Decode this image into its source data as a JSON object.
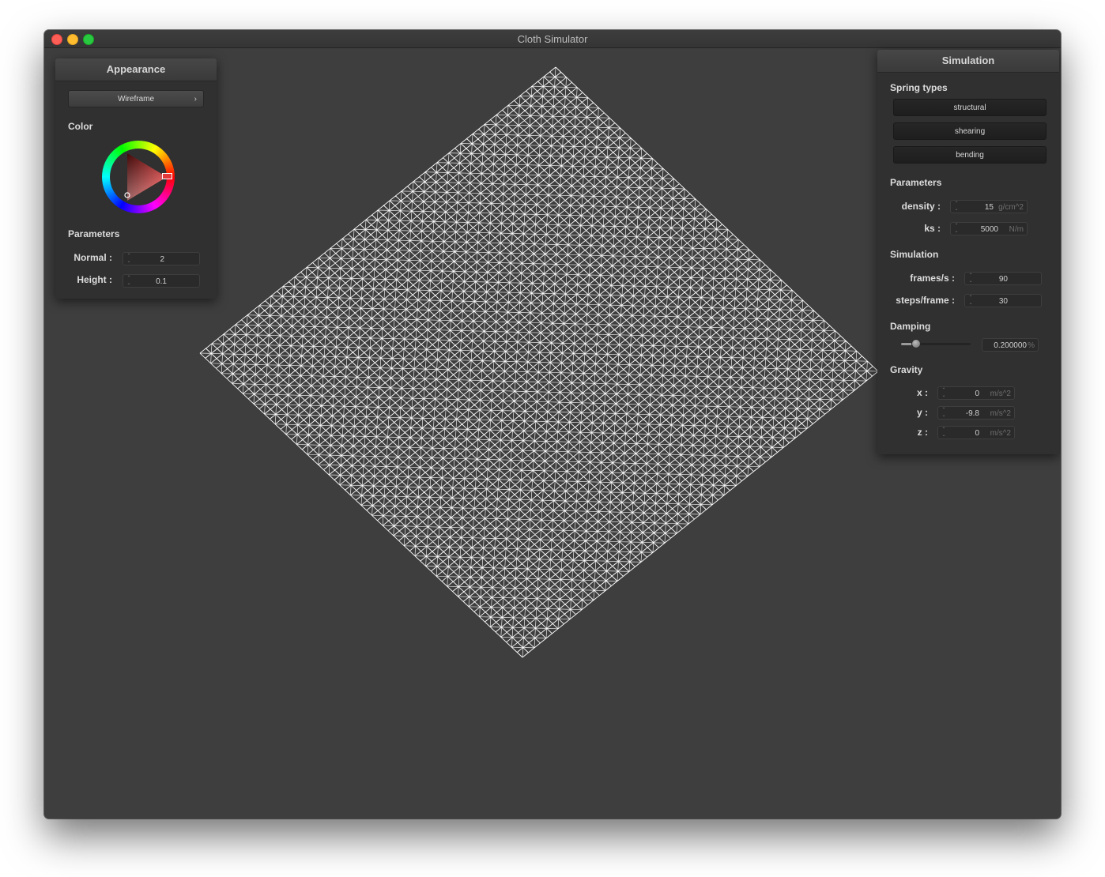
{
  "window": {
    "title": "Cloth Simulator"
  },
  "appearance": {
    "title": "Appearance",
    "shader_dropdown": "Wireframe",
    "color_label": "Color",
    "color_value": "#e23a3a",
    "parameters_label": "Parameters",
    "normal": {
      "label": "Normal :",
      "value": "2"
    },
    "height": {
      "label": "Height :",
      "value": "0.1"
    }
  },
  "simulation_panel": {
    "title": "Simulation",
    "spring_types_label": "Spring types",
    "spring_types": [
      "structural",
      "shearing",
      "bending"
    ],
    "parameters_label": "Parameters",
    "density": {
      "label": "density :",
      "value": "15",
      "unit": "g/cm^2"
    },
    "ks": {
      "label": "ks :",
      "value": "5000",
      "unit": "N/m"
    },
    "simulation_label": "Simulation",
    "frames_per_sec": {
      "label": "frames/s :",
      "value": "90"
    },
    "steps_per_frame": {
      "label": "steps/frame :",
      "value": "30"
    },
    "damping_label": "Damping",
    "damping": {
      "value": "0.200000",
      "unit": "%",
      "level": 0.2
    },
    "gravity_label": "Gravity",
    "gravity_x": {
      "label": "x :",
      "value": "0",
      "unit": "m/s^2"
    },
    "gravity_y": {
      "label": "y :",
      "value": "-9.8",
      "unit": "m/s^2"
    },
    "gravity_z": {
      "label": "z :",
      "value": "0",
      "unit": "m/s^2"
    }
  },
  "cloth": {
    "render_mode": "wireframe",
    "color": "#ffffff",
    "background": "#3e3e3e"
  }
}
